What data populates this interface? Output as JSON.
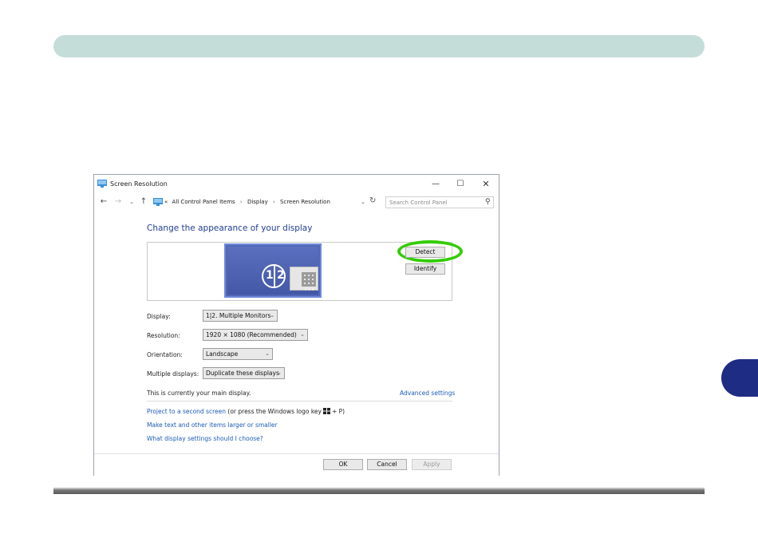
{
  "window": {
    "title": "Screen Resolution",
    "minimize": "—",
    "maximize": "☐",
    "close": "✕"
  },
  "address": {
    "back": "←",
    "forward": "→",
    "recent": "⌄",
    "up": "↑",
    "prefix": "«",
    "crumbs": [
      "All Control Panel Items",
      "Display",
      "Screen Resolution"
    ],
    "separator": "›",
    "dropdown": "⌄",
    "refresh": "↻",
    "search_placeholder": "Search Control Panel",
    "search_icon": "⚲"
  },
  "heading": "Change the appearance of your display",
  "preview": {
    "monitor_num_1": "1",
    "monitor_num_2": "2",
    "dots": "•••"
  },
  "buttons": {
    "detect": "Detect",
    "identify": "Identify",
    "ok": "OK",
    "cancel": "Cancel",
    "apply": "Apply"
  },
  "fields": {
    "display": {
      "label": "Display:",
      "value": "1|2. Multiple Monitors"
    },
    "resolution": {
      "label": "Resolution:",
      "value": "1920 × 1080 (Recommended)"
    },
    "orientation": {
      "label": "Orientation:",
      "value": "Landscape"
    },
    "multiple_displays": {
      "label": "Multiple displays:",
      "value": "Duplicate these displays"
    },
    "chevron": "⌄"
  },
  "main_note": "This is currently your main display.",
  "advanced_settings": "Advanced settings",
  "links": {
    "project": "Project to a second screen",
    "project_suffix_a": "(or press the Windows logo key",
    "project_suffix_b": "+ P)",
    "text_size": "Make text and other items larger or smaller",
    "what_settings": "What display settings should I choose?"
  },
  "colors": {
    "accent_link": "#1e5bb5",
    "heading": "#1e3f91",
    "highlight_ring": "#33cc00",
    "top_band": "#c5ddd9",
    "side_tab": "#1f2c84"
  }
}
